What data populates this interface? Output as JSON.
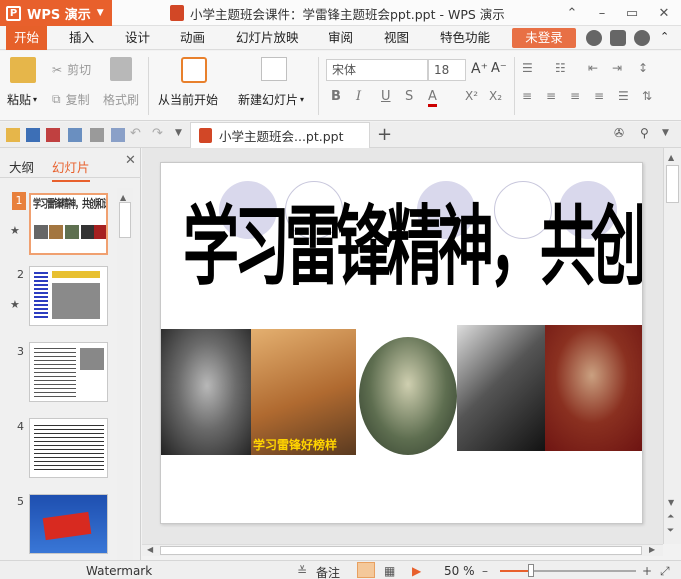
{
  "app": {
    "name": "WPS 演示",
    "logo_letter": "P",
    "window_title": "小学主题班会课件：学雷锋主题班会ppt.ppt - WPS 演示"
  },
  "menu": {
    "tabs": [
      "开始",
      "插入",
      "设计",
      "动画",
      "幻灯片放映",
      "审阅",
      "视图",
      "特色功能"
    ],
    "login": "未登录"
  },
  "ribbon": {
    "paste": "粘贴",
    "cut": "剪切",
    "copy": "复制",
    "format_painter": "格式刷",
    "from_current": "从当前开始",
    "new_slide": "新建幻灯片",
    "font_name": "宋体",
    "font_size": "18"
  },
  "doc_tab": {
    "title": "小学主题班会...pt.ppt",
    "new_tab": "+"
  },
  "left_pane": {
    "tab_outline": "大纲",
    "tab_slides": "幻灯片",
    "thumbnails": [
      {
        "num": "1",
        "label": "学习雷锋精神，共创和谐校园",
        "starred": true,
        "selected": true
      },
      {
        "num": "2",
        "starred": true
      },
      {
        "num": "3"
      },
      {
        "num": "4"
      },
      {
        "num": "5"
      }
    ]
  },
  "slide": {
    "title": "学习雷锋精神，共创和谐校园",
    "photo_caption": "学习雷锋好榜样"
  },
  "status": {
    "watermark": "Watermark",
    "notes": "备注",
    "zoom": "50 %"
  },
  "colors": {
    "accent": "#e8602c",
    "circle_fill": "#d9d8ec",
    "circle_outline": "#c8c7dc"
  }
}
